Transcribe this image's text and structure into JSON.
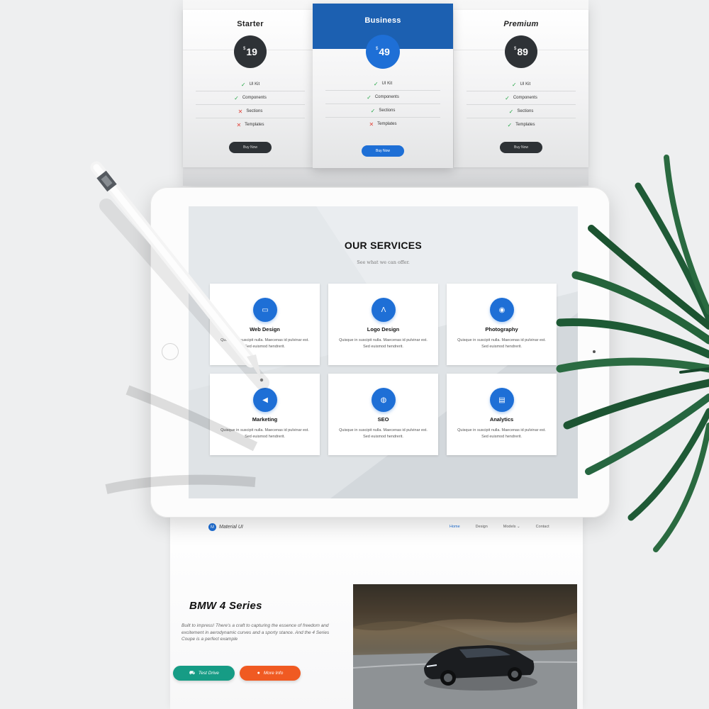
{
  "pricing": {
    "plans": [
      {
        "name": "Starter",
        "currency": "$",
        "price": "19",
        "features": [
          {
            "label": "UI Kit",
            "included": true
          },
          {
            "label": "Components",
            "included": true
          },
          {
            "label": "Sections",
            "included": false
          },
          {
            "label": "Templates",
            "included": false
          }
        ],
        "button": "Buy Now"
      },
      {
        "name": "Business",
        "currency": "$",
        "price": "49",
        "features": [
          {
            "label": "UI Kit",
            "included": true
          },
          {
            "label": "Components",
            "included": true
          },
          {
            "label": "Sections",
            "included": true
          },
          {
            "label": "Templates",
            "included": false
          }
        ],
        "button": "Buy Now"
      },
      {
        "name": "Premium",
        "currency": "$",
        "price": "89",
        "features": [
          {
            "label": "UI Kit",
            "included": true
          },
          {
            "label": "Components",
            "included": true
          },
          {
            "label": "Sections",
            "included": true
          },
          {
            "label": "Templates",
            "included": true
          }
        ],
        "button": "Buy Now"
      }
    ],
    "check_glyph": "✓",
    "cross_glyph": "✕"
  },
  "services": {
    "title": "OUR SERVICES",
    "subtitle": "See what we can offer.",
    "items": [
      {
        "name": "Web Design",
        "icon": "laptop-icon",
        "glyph": "▭",
        "desc": "Quisque in suscipit nulla. Maecenas id pulvinar est. Sed euismod hendrerit."
      },
      {
        "name": "Logo Design",
        "icon": "compass-icon",
        "glyph": "Λ",
        "desc": "Quisque in suscipit nulla. Maecenas id pulvinar est. Sed euismod hendrerit."
      },
      {
        "name": "Photography",
        "icon": "camera-icon",
        "glyph": "◉",
        "desc": "Quisque in suscipit nulla. Maecenas id pulvinar est. Sed euismod hendrerit."
      },
      {
        "name": "Marketing",
        "icon": "megaphone-icon",
        "glyph": "◀",
        "desc": "Quisque in suscipit nulla. Maecenas id pulvinar est. Sed euismod hendrerit."
      },
      {
        "name": "SEO",
        "icon": "globe-icon",
        "glyph": "◍",
        "desc": "Quisque in suscipit nulla. Maecenas id pulvinar est. Sed euismod hendrerit."
      },
      {
        "name": "Analytics",
        "icon": "chart-icon",
        "glyph": "▤",
        "desc": "Quisque in suscipit nulla. Maecenas id pulvinar est. Sed euismod hendrerit."
      }
    ]
  },
  "landing": {
    "brand_logo": "M",
    "brand_name": "Material UI",
    "nav": [
      "Home",
      "Design",
      "Models ⌄",
      "Contact"
    ],
    "hero_title": "BMW 4 Series",
    "hero_desc": "Built to impress! There's a craft to capturing the essence of freedom and excitement in aerodynamic curves and a sporty stance. And the 4 Series Coupe is a perfect example",
    "test_drive": "Test Drive",
    "test_drive_glyph": "⛟",
    "more_info": "More Info",
    "more_info_glyph": "●"
  },
  "colors": {
    "accent_blue": "#1e6fd6",
    "business_header": "#1c60b1",
    "dark_badge": "#2e3236",
    "teal_button": "#169c85",
    "orange_button": "#f05a22",
    "check_green": "#2aa84a",
    "cross_red": "#e0443a"
  }
}
